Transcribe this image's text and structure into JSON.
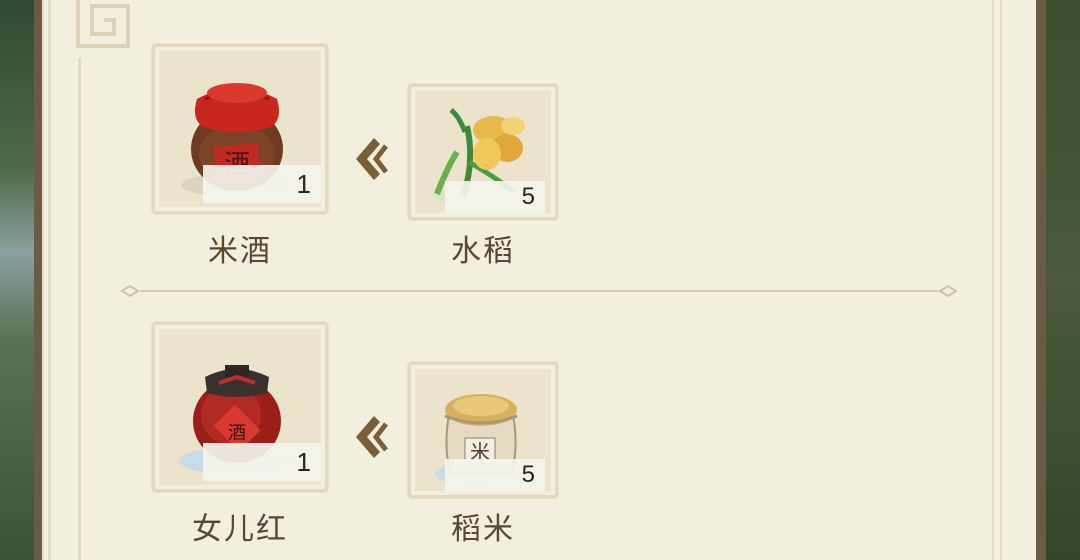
{
  "recipes": [
    {
      "output": {
        "name": "米酒",
        "quantity": "1",
        "icon": "rice-wine-jar-icon"
      },
      "input": {
        "name": "水稻",
        "quantity": "5",
        "icon": "rice-plant-icon"
      }
    },
    {
      "output": {
        "name": "女儿红",
        "quantity": "1",
        "icon": "nuerhong-wine-jar-icon"
      },
      "input": {
        "name": "稻米",
        "quantity": "5",
        "icon": "rice-sack-icon"
      }
    }
  ],
  "jar_glyph": "酒",
  "sack_glyph": "米",
  "colors": {
    "panel": "#f3efdf",
    "frame": "#6b5a44",
    "label": "#5b4630",
    "arrow": "#7a5e38",
    "wine_red": "#b3221e"
  }
}
